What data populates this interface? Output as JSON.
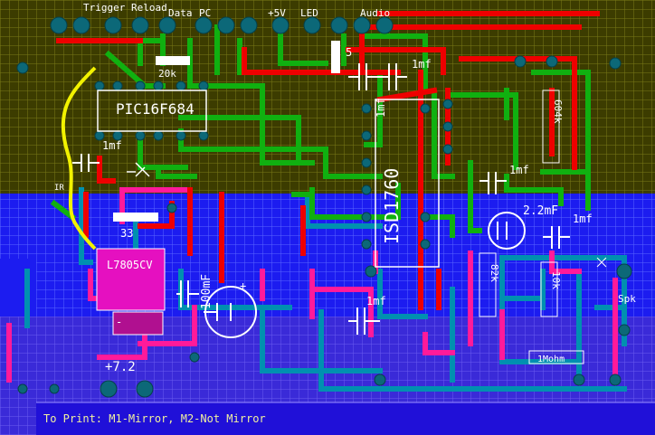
{
  "labels": {
    "header_trigger_reload": "Trigger Reload",
    "header_data": "Data",
    "header_pc": "PC",
    "header_5v": "+5V",
    "header_led": "LED",
    "header_audio": "Audio",
    "chip_main": "PIC16F684",
    "chip_sound": "ISD1760",
    "regulator": "L7805CV",
    "r_20k": "20k",
    "r_33": "33",
    "cap_1mf_a": "1mf",
    "cap_1mf_b": "1mf",
    "cap_1mf_c": "1mf",
    "cap_1mf_d": "1mf",
    "cap_1mf_e": "1mf",
    "cap_1mf_f": "1mf",
    "cap_22mf": "2.2mF",
    "cap_100mf": "100mF",
    "r_604k": "604k",
    "r_82k": "82k",
    "r_10k": "10k",
    "r_1m": "1Mohm",
    "res_5": "5",
    "ir_mark": "IR",
    "speaker": "Spk",
    "battery_plus": "+",
    "battery_minus": "-",
    "battery_72": "+7.2",
    "print_note": "To Print:  M1-Mirror, M2-Not Mirror"
  },
  "colors": {
    "top_layer": "#00b000",
    "red_trace": "#f00000",
    "bottom_layer": "#1a1aff",
    "pink_trace": "#ff1493",
    "cyan_trace": "#009ab0",
    "pad": "#0c6878",
    "grid_yellow": "#747400",
    "grid_blue": "#5560ff",
    "wire": "#f0f000",
    "label_white": "#ffffff"
  }
}
